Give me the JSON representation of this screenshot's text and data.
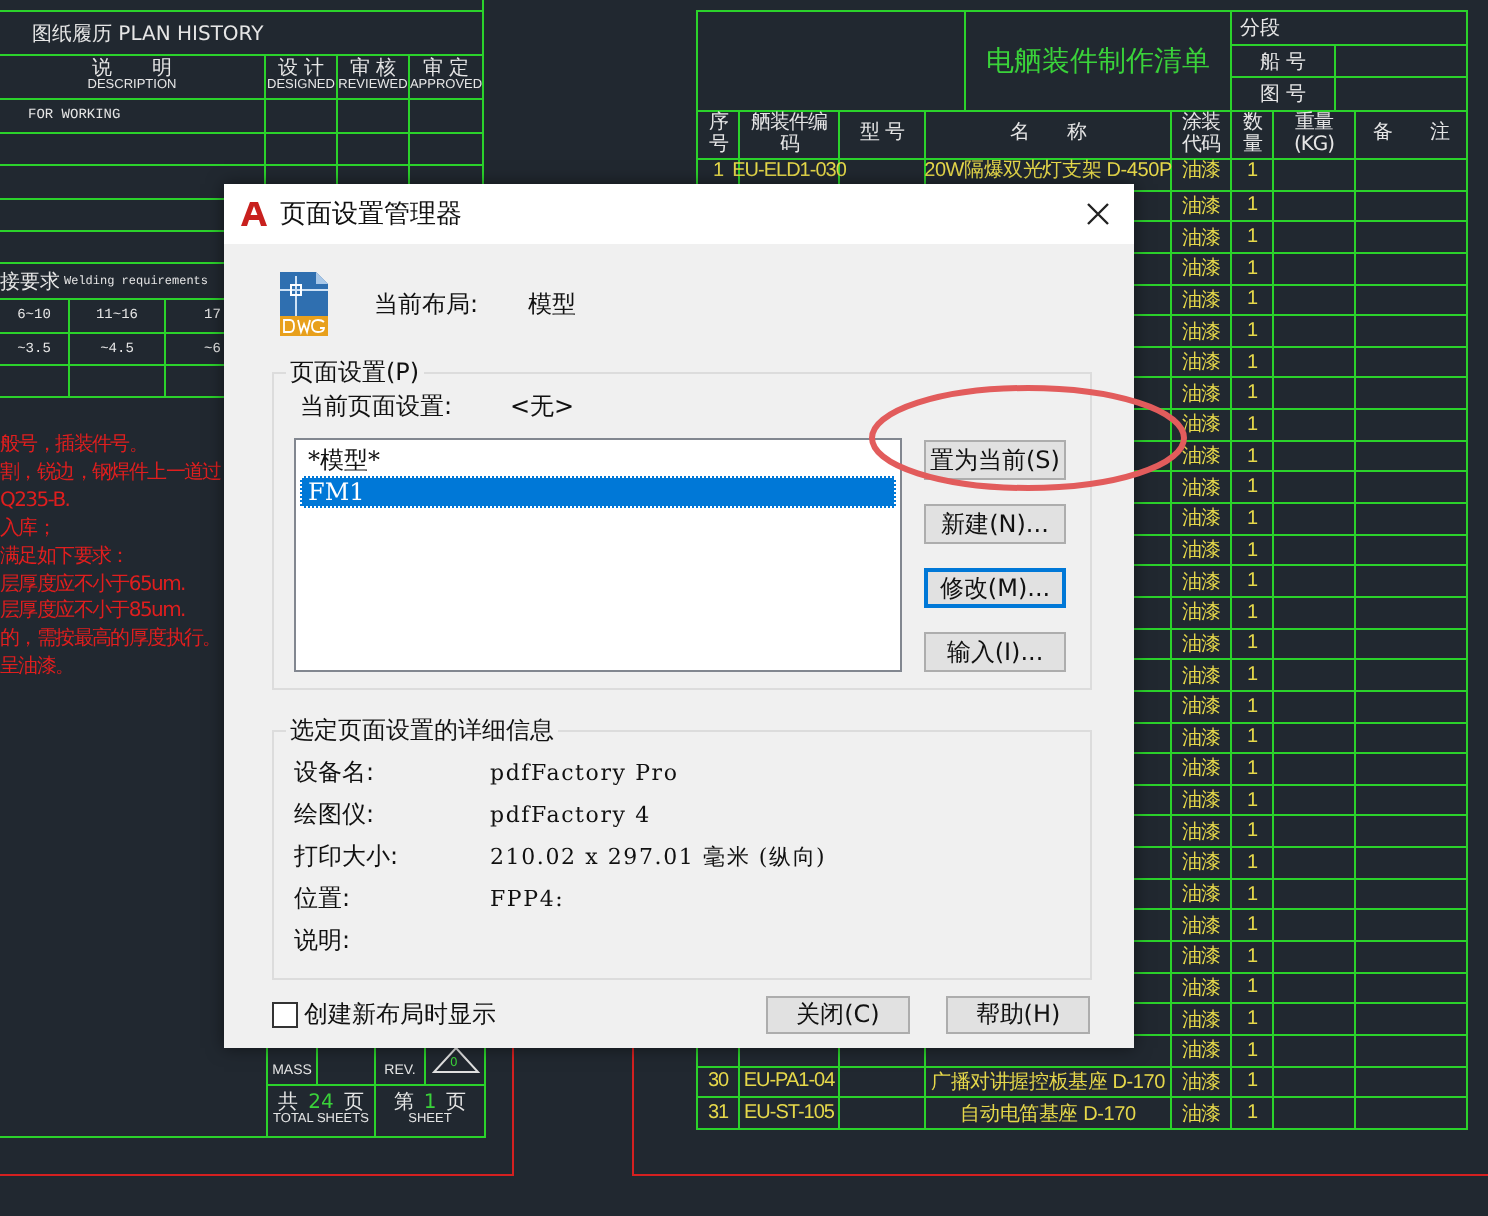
{
  "drawing": {
    "plan_history": {
      "title": "图纸履历 PLAN HISTORY",
      "columns": [
        {
          "cn": "说　　明",
          "en": "DESCRIPTION"
        },
        {
          "cn": "设 计",
          "en": "DESIGNED"
        },
        {
          "cn": "审 核",
          "en": "REVIEWED"
        },
        {
          "cn": "审 定",
          "en": "APPROVED"
        }
      ],
      "rows": [
        "FOR WORKING"
      ]
    },
    "welding": {
      "title_cn": "接要求",
      "title_en": "Welding requirements",
      "rows": [
        [
          "6~10",
          "11~16",
          "17"
        ],
        [
          "~3.5",
          "~4.5",
          "~6"
        ]
      ]
    },
    "notes": [
      "般号，插装件号。",
      "割，锐边，钢焊件上一道过",
      "Q235-B.",
      "入库；",
      "满足如下要求：",
      "层厚度应不小于65um.",
      "层厚度应不小于85um.",
      "的，需按最高的厚度执行。",
      "呈油漆。"
    ],
    "title_block": {
      "mass_label": "MASS",
      "rev_label": "REV.",
      "rev_mark": "0",
      "total_prefix": "共",
      "total": "24",
      "total_suffix": "页",
      "total_label": "TOTAL SHEETS",
      "sheet_prefix": "第",
      "sheet": "1",
      "sheet_suffix": "页",
      "sheet_label": "SHEET"
    },
    "parts_list": {
      "title": "电舾装件制作清单",
      "info": [
        "分段",
        "船 号",
        "图 号"
      ],
      "columns": [
        "序号",
        "舾装件编码",
        "型 号",
        "名　　称",
        "涂装代码",
        "数量",
        "重量(KG)",
        "备　　注"
      ],
      "rows": [
        {
          "no": "1",
          "code": "EU-ELD1-030",
          "name": "20W隔爆双光灯支架 D-450P",
          "paint": "油漆",
          "qty": "1"
        },
        {
          "paint": "油漆",
          "qty": "1"
        },
        {
          "paint": "油漆",
          "qty": "1"
        },
        {
          "paint": "油漆",
          "qty": "1"
        },
        {
          "paint": "油漆",
          "qty": "1"
        },
        {
          "paint": "油漆",
          "qty": "1"
        },
        {
          "paint": "油漆",
          "qty": "1"
        },
        {
          "paint": "油漆",
          "qty": "1"
        },
        {
          "paint": "油漆",
          "qty": "1"
        },
        {
          "paint": "油漆",
          "qty": "1"
        },
        {
          "paint": "油漆",
          "qty": "1"
        },
        {
          "paint": "油漆",
          "qty": "1"
        },
        {
          "paint": "油漆",
          "qty": "1"
        },
        {
          "paint": "油漆",
          "qty": "1"
        },
        {
          "paint": "油漆",
          "qty": "1"
        },
        {
          "paint": "油漆",
          "qty": "1"
        },
        {
          "paint": "油漆",
          "qty": "1"
        },
        {
          "paint": "油漆",
          "qty": "1"
        },
        {
          "paint": "油漆",
          "qty": "1"
        },
        {
          "paint": "油漆",
          "qty": "1"
        },
        {
          "paint": "油漆",
          "qty": "1"
        },
        {
          "paint": "油漆",
          "qty": "1"
        },
        {
          "paint": "油漆",
          "qty": "1"
        },
        {
          "paint": "油漆",
          "qty": "1"
        },
        {
          "paint": "油漆",
          "qty": "1"
        },
        {
          "paint": "油漆",
          "qty": "1"
        },
        {
          "paint": "油漆",
          "qty": "1"
        },
        {
          "paint": "油漆",
          "qty": "1"
        },
        {
          "paint": "油漆",
          "qty": "1"
        },
        {
          "no": "30",
          "code": "EU-PA1-04",
          "name": "广播对讲握控板基座 D-170",
          "paint": "油漆",
          "qty": "1"
        },
        {
          "no": "31",
          "code": "EU-ST-105",
          "name": "自动电笛基座 D-170",
          "paint": "油漆",
          "qty": "1"
        }
      ]
    }
  },
  "dialog": {
    "title": "页面设置管理器",
    "current_layout_label": "当前布局:",
    "current_layout": "模型",
    "page_setups": {
      "legend": "页面设置(P)",
      "current_label": "当前页面设置:",
      "current_value": "<无>",
      "items": [
        {
          "label": "*模型*",
          "selected": false
        },
        {
          "label": "FM1",
          "selected": true
        }
      ],
      "buttons": [
        {
          "label": "置为当前(S)",
          "focused": false
        },
        {
          "label": "新建(N)...",
          "focused": false
        },
        {
          "label": "修改(M)...",
          "focused": true
        },
        {
          "label": "输入(I)...",
          "focused": false
        }
      ]
    },
    "details": {
      "legend": "选定页面设置的详细信息",
      "rows": [
        {
          "label": "设备名:",
          "value": "pdfFactory Pro"
        },
        {
          "label": "绘图仪:",
          "value": "pdfFactory 4"
        },
        {
          "label": "打印大小:",
          "value": "210.02 x 297.01 毫米 (纵向)"
        },
        {
          "label": "位置:",
          "value": "FPP4:"
        },
        {
          "label": "说明:"
        }
      ]
    },
    "show_on_create": {
      "label": "创建新布局时显示",
      "checked": false
    },
    "footer_buttons": [
      "关闭(C)",
      "帮助(H)"
    ]
  }
}
